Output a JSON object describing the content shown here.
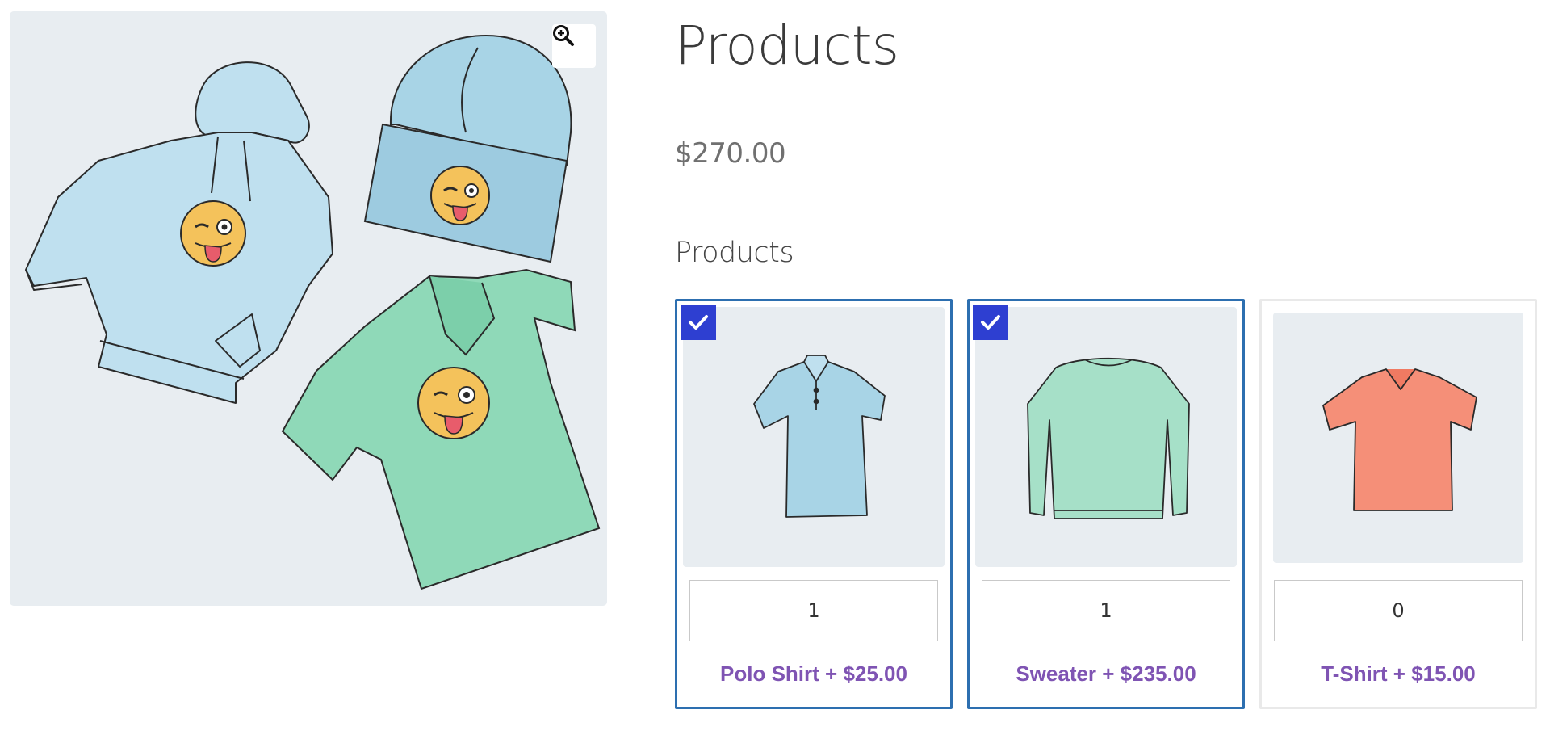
{
  "product": {
    "title": "Products",
    "price": "$270.00"
  },
  "gallery": {
    "image_icon": "hoodie-beanie-tshirt-illustration",
    "zoom_icon": "magnifier-plus-icon"
  },
  "bundle": {
    "section_label": "Products",
    "items": [
      {
        "label": "Polo Shirt + $25.00",
        "quantity": "1",
        "selected": true,
        "image_icon": "polo-shirt-illustration",
        "color": "#a8d4e6"
      },
      {
        "label": "Sweater + $235.00",
        "quantity": "1",
        "selected": true,
        "image_icon": "sweater-illustration",
        "color": "#a6e0c8"
      },
      {
        "label": "T-Shirt + $15.00",
        "quantity": "0",
        "selected": false,
        "image_icon": "tshirt-illustration",
        "color": "#f58f78"
      }
    ]
  },
  "colors": {
    "selected_border": "#2d6fb0",
    "check_bg": "#2e3fd1",
    "link": "#7f54b3",
    "image_bg": "#e8edf1"
  }
}
